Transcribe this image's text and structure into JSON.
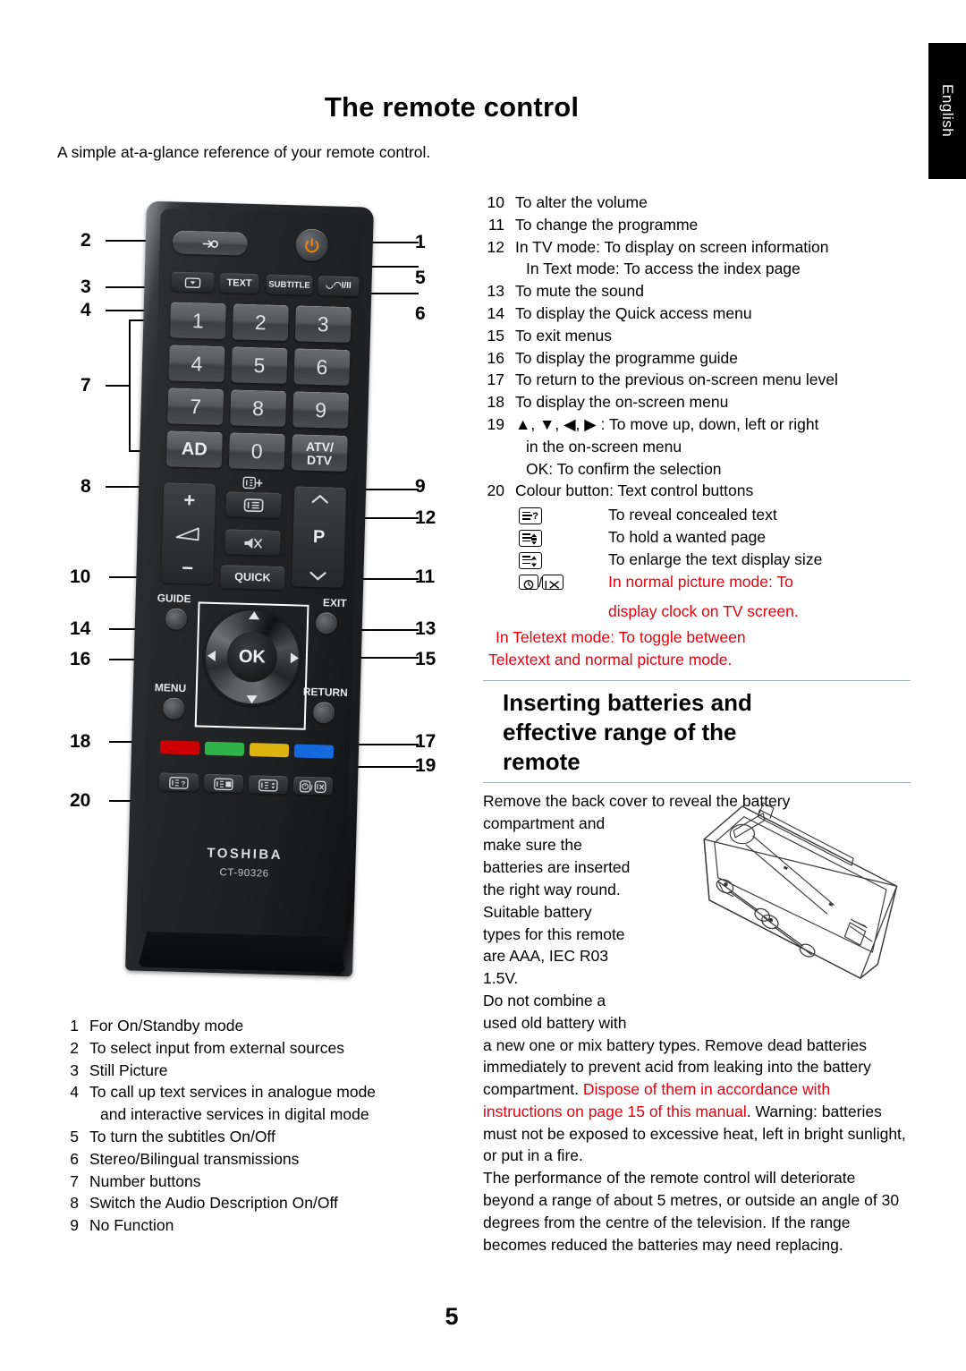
{
  "lang_tab": {
    "label": "English"
  },
  "header": {
    "title": "The remote control",
    "subtitle": "A simple at-a-glance reference of your remote control."
  },
  "page_number": "5",
  "remote": {
    "brand": "TOSHIBA",
    "model": "CT-90326",
    "buttons": {
      "source": "source-icon",
      "power": "power-icon",
      "still": "still-picture-icon",
      "text": "TEXT",
      "subtitle": "SUBTITLE",
      "stereo": "I/II",
      "n1": "1",
      "n2": "2",
      "n3": "3",
      "n4": "4",
      "n5": "5",
      "n6": "6",
      "n7": "7",
      "n8": "8",
      "n9": "9",
      "ad": "AD",
      "n0": "0",
      "atv_dtv": "ATV/\nDTV",
      "info": "info-icon",
      "volume_plus": "+",
      "volume_icon": "volume-icon",
      "volume_minus": "−",
      "mute": "mute-icon",
      "quick": "QUICK",
      "prog_up": "prog-up-icon",
      "prog_label": "P",
      "prog_down": "prog-down-icon",
      "guide": "GUIDE",
      "exit": "EXIT",
      "menu": "MENU",
      "return": "RETURN",
      "ok": "OK"
    },
    "colour_buttons": [
      "#cc0000",
      "#2db34a",
      "#ddb310",
      "#1668dd"
    ]
  },
  "left_callouts": [
    "2",
    "3",
    "4",
    "7",
    "8",
    "10",
    "14",
    "16",
    "18",
    "20"
  ],
  "right_callouts": [
    "1",
    "5",
    "6",
    "9",
    "12",
    "11",
    "13",
    "15",
    "17",
    "19"
  ],
  "left_list": [
    {
      "n": "1",
      "text": "For On/Standby mode"
    },
    {
      "n": "2",
      "text": "To select input from external sources"
    },
    {
      "n": "3",
      "text": "Still Picture"
    },
    {
      "n": "4",
      "text": "To call up text services in analogue mode",
      "cont": "and interactive services in digital mode"
    },
    {
      "n": "5",
      "text": "To turn the subtitles On/Off"
    },
    {
      "n": "6",
      "text": "Stereo/Bilingual transmissions"
    },
    {
      "n": "7",
      "text": "Number buttons"
    },
    {
      "n": "8",
      "text": "Switch the Audio Description On/Off"
    },
    {
      "n": "9",
      "text": "No Function"
    }
  ],
  "right_list": [
    {
      "n": "10",
      "text": "To alter the volume"
    },
    {
      "n": "11",
      "text": "To change the programme"
    },
    {
      "n": "12",
      "text": "In TV mode: To display on screen information",
      "cont": "In Text mode: To access the index page"
    },
    {
      "n": "13",
      "text": "To mute the sound"
    },
    {
      "n": "14",
      "text": "To display the Quick access menu"
    },
    {
      "n": "15",
      "text": "To exit menus"
    },
    {
      "n": "16",
      "text": "To display the programme guide"
    },
    {
      "n": "17",
      "text": "To return to the previous on-screen menu level"
    },
    {
      "n": "18",
      "text": "To display the on-screen menu"
    },
    {
      "n": "19",
      "text": "▲, ▼, ◀, ▶ : To move up, down, left or right",
      "cont": "in the on-screen menu",
      "cont2": "OK: To confirm the selection"
    },
    {
      "n": "20",
      "text": "Colour button: Text control buttons"
    }
  ],
  "teletext_rows": [
    {
      "icon": "reveal-text-icon",
      "text": "To reveal concealed text",
      "colour": "#000000"
    },
    {
      "icon": "hold-page-icon",
      "text": "To hold a wanted page",
      "colour": "#000000"
    },
    {
      "icon": "enlarge-text-icon",
      "text": "To enlarge the text display size",
      "colour": "#000000"
    },
    {
      "icon": "clock-exit-icon",
      "text": "In normal picture mode:  To",
      "colour": "#e8000d"
    }
  ],
  "teletext_extra": [
    {
      "text": "display clock on TV screen.",
      "colour": "#e8000d",
      "indent": true
    },
    {
      "text": "In Teletext mode:  To toggle between",
      "colour": "#e8000d",
      "indent": false
    },
    {
      "text": "Telextext and normal picture mode.",
      "colour": "#e8000d",
      "indent": false
    }
  ],
  "battery_section": {
    "heading_lines": [
      "Inserting batteries and",
      "effective range of the",
      "remote"
    ],
    "wrap_lines": [
      "Remove the back cover to reveal the battery",
      "compartment and",
      "make sure the",
      "batteries are inserted",
      "the right way round.",
      "Suitable battery",
      "types for this remote",
      "are AAA, IEC R03",
      "1.5V.",
      "Do not combine a",
      "used old battery with"
    ],
    "para_before_red": "a new one or mix battery types. Remove dead batteries immediately to prevent acid from leaking into the battery compartment. ",
    "para_red": "Dispose of them in accordance with instructions on page 15 of this manual",
    "para_after_red": ". Warning: batteries must not be exposed to excessive heat, left in bright sunlight, or put in a fire.",
    "para_final": "The performance of the remote control will deteriorate beyond a range of about 5 metres, or outside an angle of 30 degrees from the centre of the television. If the range becomes reduced the batteries may need replacing.",
    "illustration": "battery-compartment-diagram"
  },
  "colors": {
    "red": "#e8000d",
    "rule": "#9fb4bd"
  }
}
